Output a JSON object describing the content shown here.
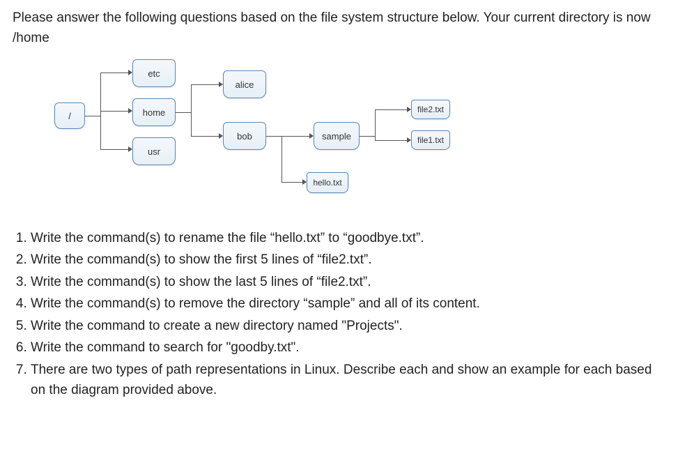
{
  "intro_line1": "Please answer the following questions based on the file system structure below. Your current directory is now",
  "intro_line2": "/home",
  "nodes": {
    "root": "/",
    "etc": "etc",
    "home": "home",
    "usr": "usr",
    "alice": "alice",
    "bob": "bob",
    "sample": "sample",
    "hello": "hello.txt",
    "file2": "file2.txt",
    "file1": "file1.txt"
  },
  "questions": {
    "q1": "Write the command(s) to rename the file “hello.txt” to “goodbye.txt”.",
    "q2": "Write the command(s) to show the first 5 lines of “file2.txt”.",
    "q3": "Write the command(s) to show the last 5 lines of “file2.txt”.",
    "q4": "Write the command(s) to remove the directory “sample” and all of its content.",
    "q5": "Write the command to create a new directory named \"Projects\".",
    "q6": "Write the command to search for \"goodby.txt\".",
    "q7a": "There are two types of path representations in Linux. Describe each and show an example for each based",
    "q7b": "on the diagram provided above."
  }
}
